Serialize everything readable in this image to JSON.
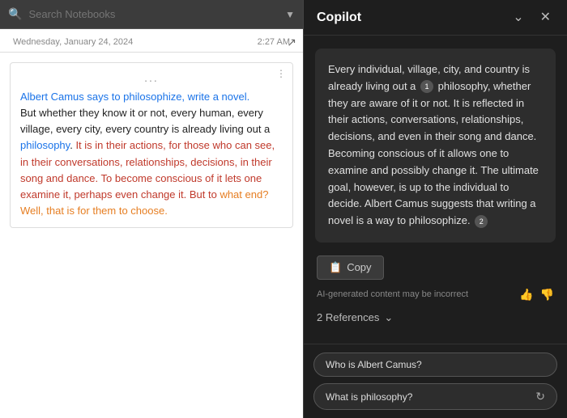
{
  "search": {
    "placeholder": "Search Notebooks"
  },
  "note": {
    "date": "Wednesday, January 24, 2024",
    "time": "2:27 AM",
    "dots": "...",
    "segments": [
      {
        "text": "Albert Camus says to philosophize, write a novel.",
        "color": "normal"
      },
      {
        "text": " But whether they know it or not, every human, every village, every city, every country is already living out a philosophy. It is in their actions, for those who can see, in their conversations, relationships, decisions, in their song and dance. To become conscious of it lets one examine it, perhaps even change it. But to what end? Well, that is for them to choose.",
        "color": "mixed"
      }
    ]
  },
  "copilot": {
    "title": "Copilot",
    "minimize_label": "minimize",
    "close_label": "close",
    "response": "Every individual, village, city, and country is already living out a philosophy, whether they are aware of it or not. It is reflected in their actions, conversations, relationships, decisions, and even in their song and dance. Becoming conscious of it allows one to examine and possibly change it. The ultimate goal, however, is up to the individual to decide. Albert Camus suggests that writing a novel is a way to philosophize.",
    "ref1": "1",
    "ref2": "2",
    "copy_label": "Copy",
    "ai_disclaimer": "AI-generated content may be incorrect",
    "references_label": "2 References",
    "suggestions": [
      {
        "label": "Who is Albert Camus?",
        "has_refresh": false
      },
      {
        "label": "What is philosophy?",
        "has_refresh": true
      }
    ]
  }
}
